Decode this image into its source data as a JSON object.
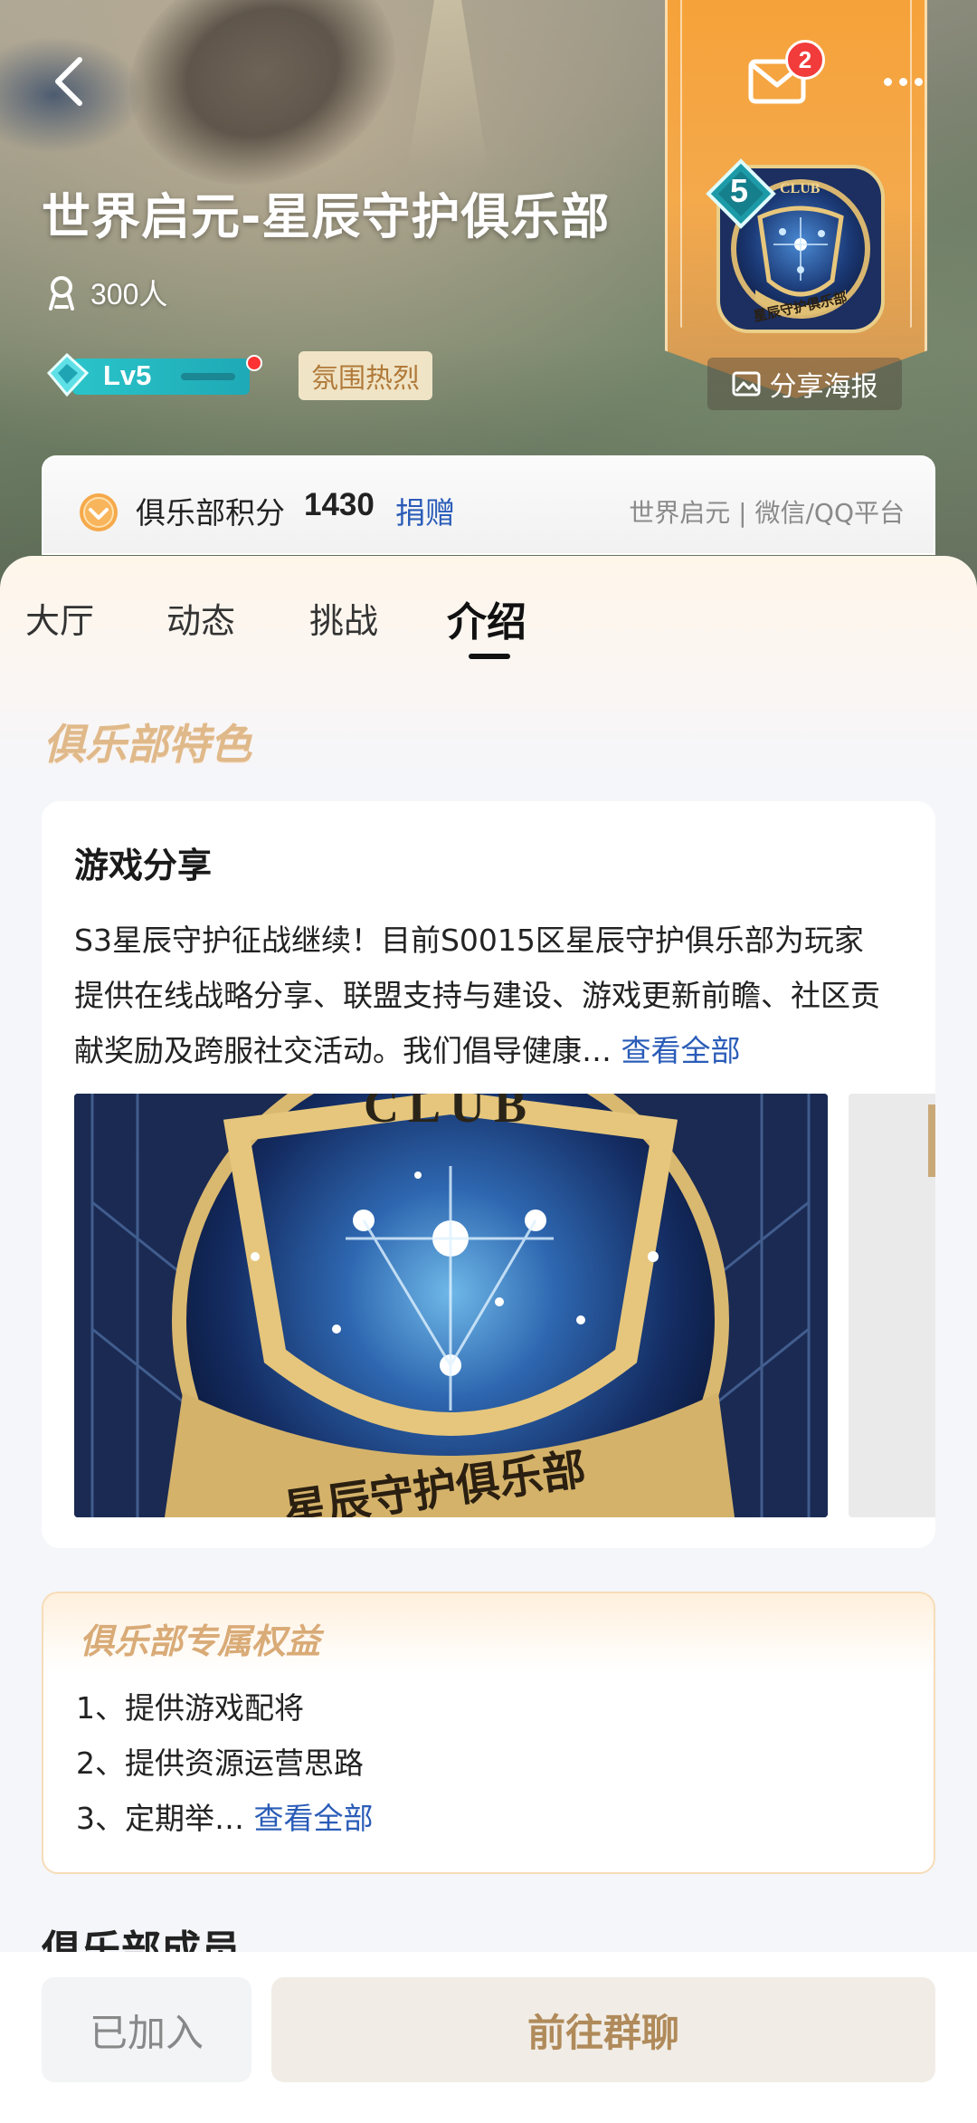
{
  "header": {
    "mail_badge": "2",
    "club_name": "世界启元-星辰守护俱乐部",
    "member_count": "300人",
    "level_label": "Lv5",
    "mood_tag": "氛围热烈",
    "emblem_level": "5",
    "emblem_top_text": "CLUB",
    "emblem_bottom_text": "星辰守护俱乐部",
    "share_poster": "分享海报"
  },
  "points": {
    "label": "俱乐部积分",
    "value": "1430",
    "donate": "捐赠",
    "platform": "世界启元 | 微信/QQ平台"
  },
  "tabs": [
    {
      "label": "大厅"
    },
    {
      "label": "动态"
    },
    {
      "label": "挑战"
    },
    {
      "label": "介绍"
    }
  ],
  "active_tab": "介绍",
  "features": {
    "section_title": "俱乐部特色",
    "card_title": "游戏分享",
    "description": "S3星辰守护征战继续！目前S0015区星辰守护俱乐部为玩家提供在线战略分享、联盟支持与建设、游戏更新前瞻、社区贡献奖励及跨服社交活动。我们倡导健康…",
    "view_all": "查看全部",
    "image_top_text": "CLUB",
    "image_bottom_text": "星辰守护俱乐部"
  },
  "rights": {
    "title": "俱乐部专属权益",
    "items": [
      "1、提供游戏配将",
      "2、提供资源运营思路",
      "3、定期举…"
    ],
    "view_all": "查看全部"
  },
  "members": {
    "title": "俱乐部成员"
  },
  "bottom": {
    "joined": "已加入",
    "go_chat": "前往群聊"
  }
}
